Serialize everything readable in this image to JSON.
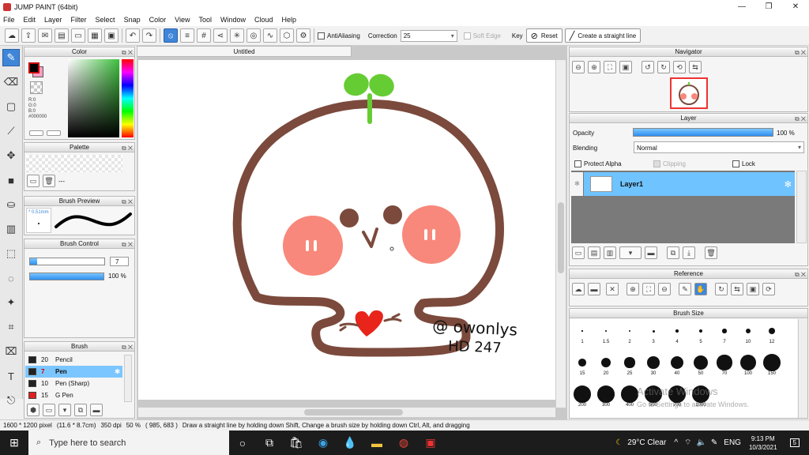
{
  "window": {
    "title": "JUMP PAINT (64bit)",
    "minimize": "—",
    "maximize": "❐",
    "close": "✕"
  },
  "menu": [
    "File",
    "Edit",
    "Layer",
    "Filter",
    "Select",
    "Snap",
    "Color",
    "View",
    "Tool",
    "Window",
    "Cloud",
    "Help"
  ],
  "toolbar": {
    "antialiasing": "AntiAliasing",
    "correction_label": "Correction",
    "correction_value": "25",
    "soft_edge": "Soft Edge",
    "key_label": "Key",
    "reset_label": "Reset",
    "straight_line_label": "Create a straight line"
  },
  "document": {
    "tab_title": "Untitled"
  },
  "color_panel": {
    "title": "Color",
    "r": "R:0",
    "g": "G:0",
    "b": "B:0",
    "hex": "#000000",
    "primary": "#000000",
    "secondary": "#ff9fc4"
  },
  "palette_panel": {
    "title": "Palette",
    "entry": "---"
  },
  "brush_preview": {
    "title": "Brush Preview",
    "size": "* 0.51mm"
  },
  "brush_control": {
    "title": "Brush Control",
    "size_value": "7",
    "opacity_value": "100 %"
  },
  "brush_panel": {
    "title": "Brush",
    "items": [
      {
        "size": "20",
        "name": "Pencil",
        "color": "#222222",
        "selected": false
      },
      {
        "size": "7",
        "name": "Pen",
        "color": "#222222",
        "selected": true
      },
      {
        "size": "10",
        "name": "Pen (Sharp)",
        "color": "#222222",
        "selected": false
      },
      {
        "size": "15",
        "name": "G Pen",
        "color": "#e02020",
        "selected": false
      }
    ]
  },
  "navigator": {
    "title": "Navigator"
  },
  "layer_panel": {
    "title": "Layer",
    "opacity_label": "Opacity",
    "opacity_value": "100 %",
    "blending_label": "Blending",
    "blending_value": "Normal",
    "protect_alpha": "Protect Alpha",
    "clipping": "Clipping",
    "lock": "Lock",
    "layer_name": "Layer1"
  },
  "reference": {
    "title": "Reference"
  },
  "brush_size": {
    "title": "Brush Size",
    "sizes": [
      "1",
      "1.5",
      "2",
      "3",
      "4",
      "5",
      "7",
      "10",
      "12",
      "15",
      "20",
      "25",
      "30",
      "40",
      "50",
      "70",
      "100",
      "150",
      "200",
      "300",
      "400",
      "500",
      "700",
      "1000"
    ]
  },
  "watermark": {
    "line1": "Activate Windows",
    "line2": "Go to Settings to activate Windows."
  },
  "artwork": {
    "signature_line1": "@ owonlys",
    "signature_line2": "HD 247"
  },
  "status": {
    "dims": "1600 * 1200 pixel",
    "size": "(11.6 * 8.7cm)",
    "dpi": "350 dpi",
    "zoom": "50 %",
    "coords": "( 985, 683 )",
    "hint": "Draw a straight line by holding down Shift, Change a brush size by holding down Ctrl, Alt, and dragging"
  },
  "taskbar": {
    "search_placeholder": "Type here to search",
    "weather": "29°C  Clear",
    "lang": "ENG",
    "time": "9:13 PM",
    "date": "10/3/2021",
    "notif_count": "5"
  }
}
